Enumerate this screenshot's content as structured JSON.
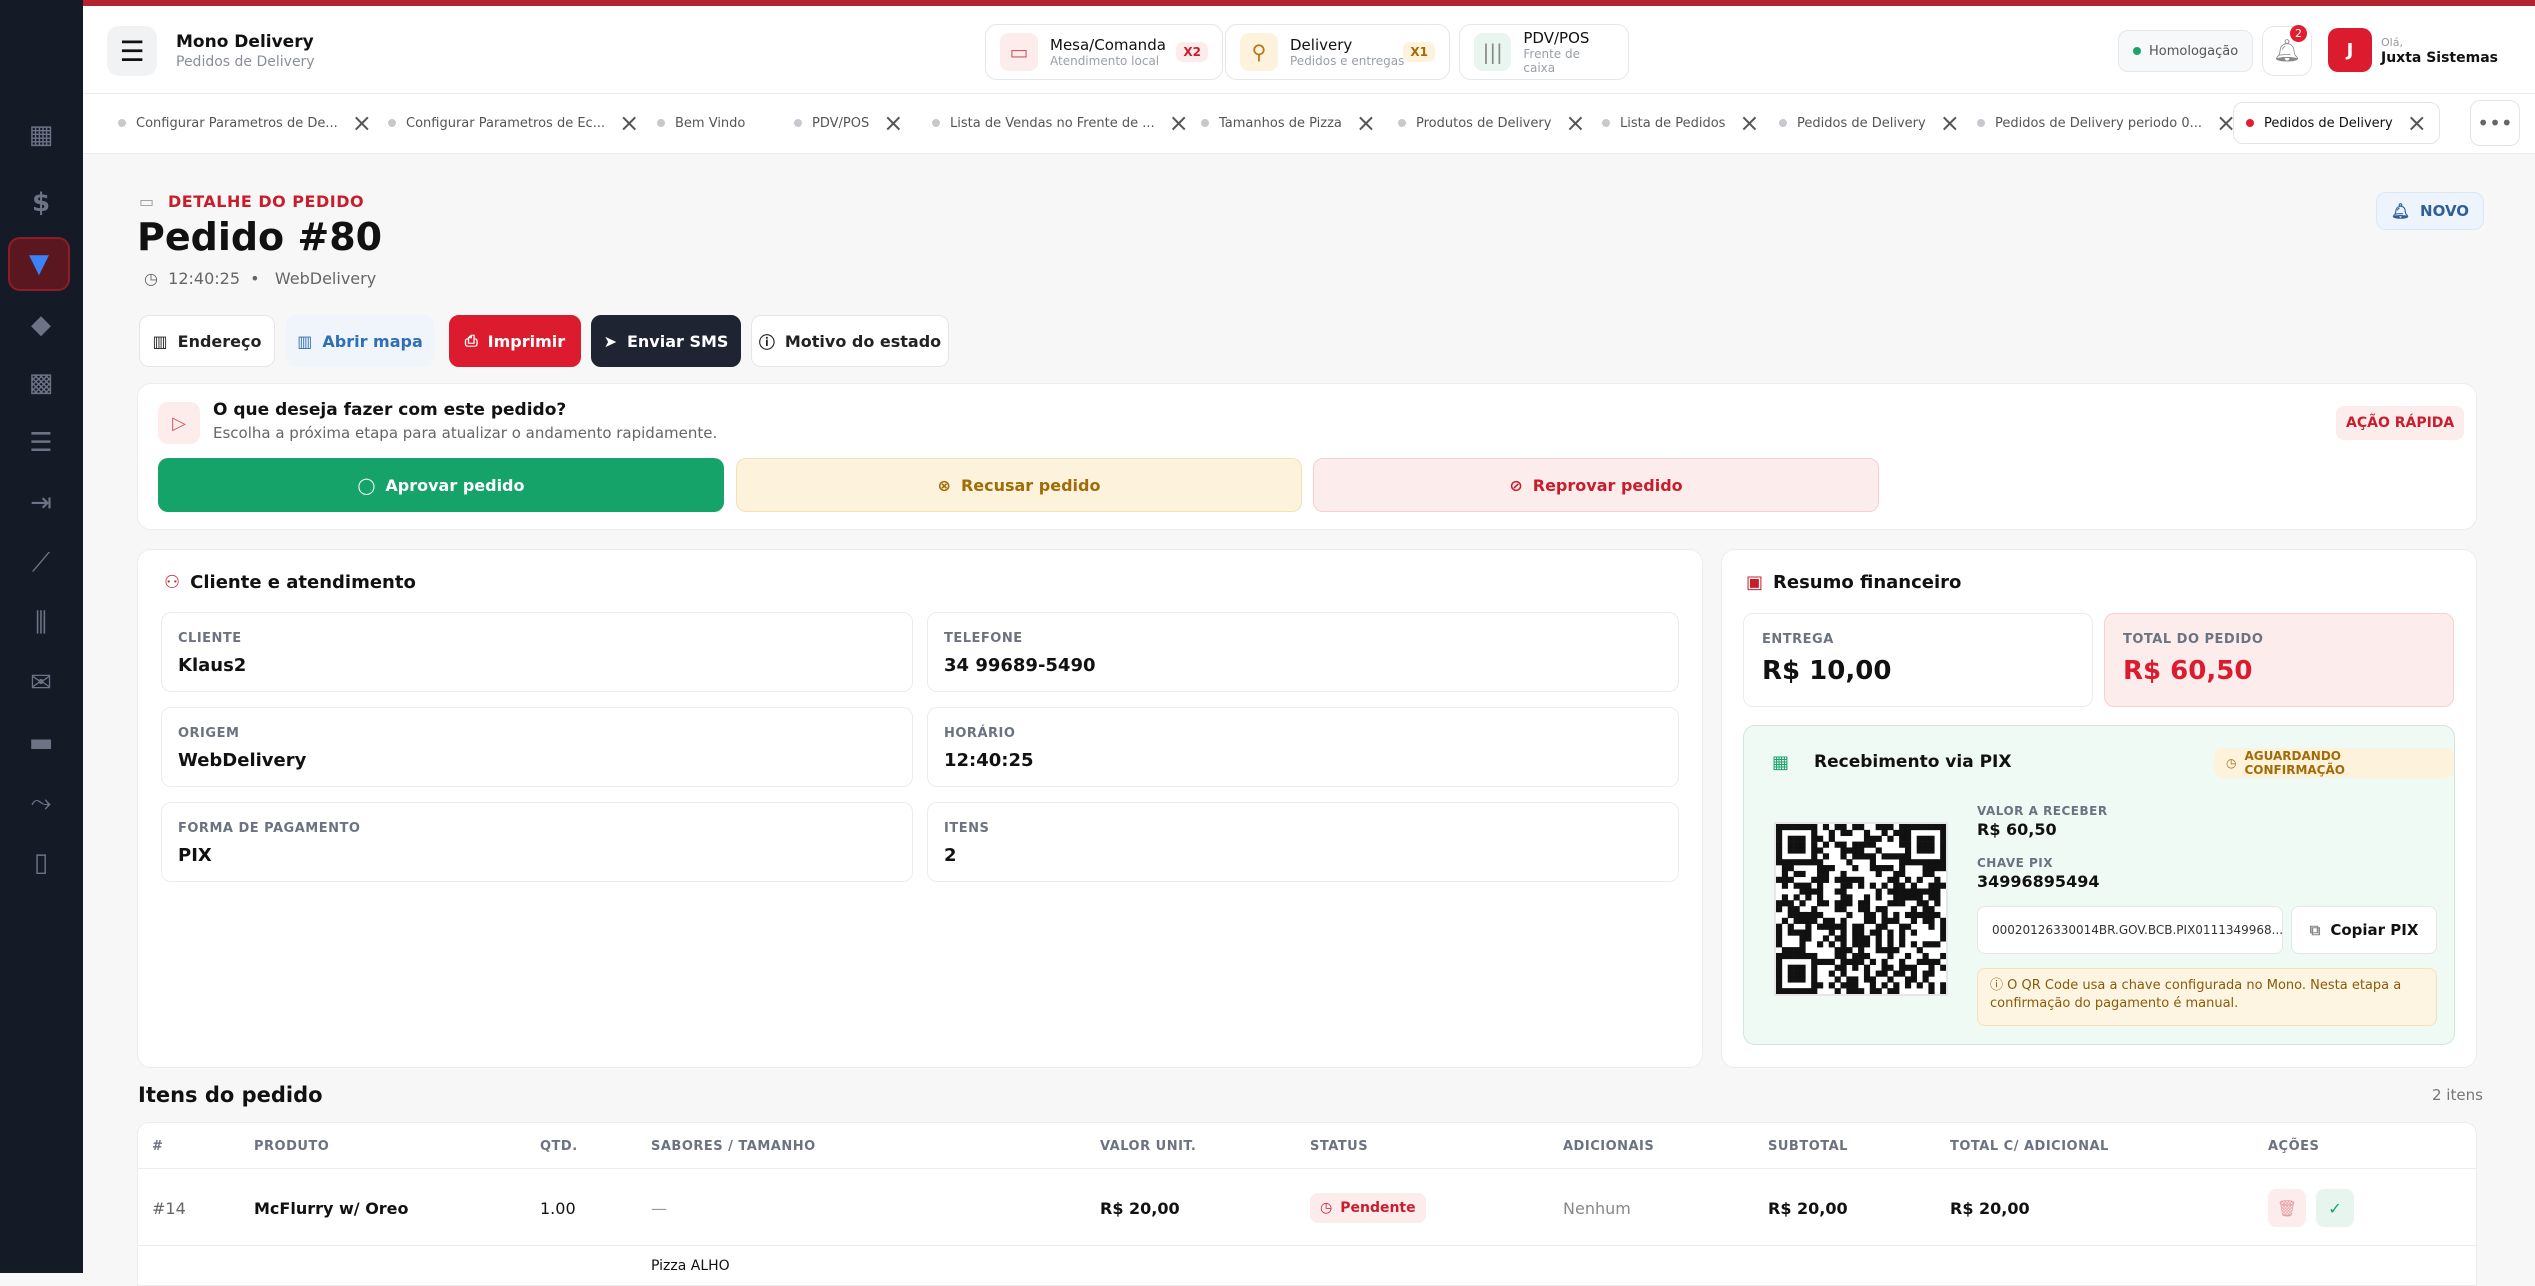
{
  "header": {
    "brand_title": "Mono Delivery",
    "brand_subtitle": "Pedidos de Delivery",
    "modules": [
      {
        "title": "Mesa/Comanda",
        "subtitle": "Atendimento local",
        "badge": "X2"
      },
      {
        "title": "Delivery",
        "subtitle": "Pedidos e entregas",
        "badge": "X1"
      },
      {
        "title": "PDV/POS",
        "subtitle": "Frente de caixa"
      }
    ],
    "environment": "Homologação",
    "notifications": "2",
    "avatar_letter": "J",
    "account_small": "Olá,",
    "account_name": "Juxta Sistemas"
  },
  "tabs": [
    "Configurar Parametros de De...",
    "Configurar Parametros de Ec...",
    "Bem Vindo",
    "PDV/POS",
    "Lista de Vendas no Frente de ...",
    "Tamanhos de Pizza",
    "Produtos de Delivery",
    "Lista de Pedidos",
    "Pedidos de Delivery",
    "Pedidos de Delivery periodo 0...",
    "Pedidos de Delivery"
  ],
  "order": {
    "eyebrow": "DETALHE DO PEDIDO",
    "title": "Pedido #80",
    "time": "12:40:25",
    "source": "WebDelivery",
    "status": "NOVO"
  },
  "buttons": {
    "address": "Endereço",
    "map": "Abrir mapa",
    "print": "Imprimir",
    "sms": "Enviar SMS",
    "reason": "Motivo do estado"
  },
  "quick": {
    "title": "O que deseja fazer com este pedido?",
    "subtitle": "Escolha a próxima etapa para atualizar o andamento rapidamente.",
    "badge": "AÇÃO RÁPIDA",
    "approve": "Aprovar pedido",
    "refuse": "Recusar pedido",
    "reject": "Reprovar pedido"
  },
  "client": {
    "section": "Cliente e atendimento",
    "fields": [
      {
        "label": "CLIENTE",
        "value": "Klaus2"
      },
      {
        "label": "TELEFONE",
        "value": "34 99689-5490"
      },
      {
        "label": "ORIGEM",
        "value": "WebDelivery"
      },
      {
        "label": "HORÁRIO",
        "value": "12:40:25"
      },
      {
        "label": "FORMA DE PAGAMENTO",
        "value": "PIX"
      },
      {
        "label": "ITENS",
        "value": "2"
      }
    ]
  },
  "finance": {
    "section": "Resumo financeiro",
    "delivery_label": "ENTREGA",
    "delivery_value": "R$ 10,00",
    "total_label": "TOTAL DO PEDIDO",
    "total_value": "R$ 60,50",
    "pix": {
      "title": "Recebimento via PIX",
      "status": "AGUARDANDO CONFIRMAÇÃO",
      "amount_label": "VALOR A RECEBER",
      "amount": "R$ 60,50",
      "key_label": "CHAVE PIX",
      "key": "34996895494",
      "code": "00020126330014BR.GOV.BCB.PIX0111349968...",
      "copy": "Copiar PIX",
      "note": "O QR Code usa a chave configurada no Mono. Nesta etapa a confirmação do pagamento é manual."
    }
  },
  "items": {
    "title": "Itens do pedido",
    "count": "2 itens",
    "columns": [
      "#",
      "PRODUTO",
      "QTD.",
      "SABORES / TAMANHO",
      "VALOR UNIT.",
      "STATUS",
      "ADICIONAIS",
      "SUBTOTAL",
      "TOTAL C/ ADICIONAL",
      "AÇÕES"
    ],
    "rows": [
      {
        "id": "#14",
        "product": "McFlurry w/ Oreo",
        "qty": "1.00",
        "flavors": "—",
        "unit": "R$ 20,00",
        "status": "Pendente",
        "extras": "Nenhum",
        "subtotal": "R$ 20,00",
        "total": "R$ 20,00"
      }
    ],
    "partial_row_text": "Pizza ALHO"
  },
  "colors": {
    "brand_red": "#dc1c2e",
    "approve_green": "#16a36a",
    "sidebar": "#151a27"
  }
}
